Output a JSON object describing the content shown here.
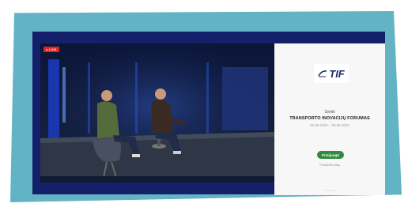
{
  "video": {
    "live_badge": "● LIVE"
  },
  "sidebar": {
    "logo_text": "TIF",
    "greeting": "Sveiki",
    "event_title": "TRANSPORTO INOVACIJŲ FORUMAS",
    "event_dates": "05.05.2022 – 06.05.2022",
    "join_button": "Prisijungti",
    "secondary_link": "Peržiūrėti įrašą",
    "footer": "Powered by"
  },
  "colors": {
    "frame": "#62b3c4",
    "screen": "#14206a",
    "accent": "#2e8b3d",
    "live": "#e02424"
  }
}
